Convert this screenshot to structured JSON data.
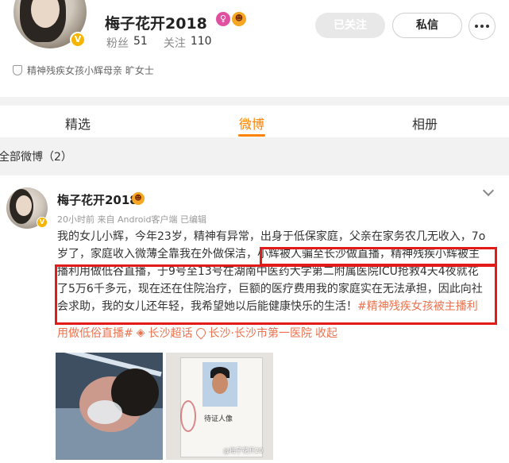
{
  "profile": {
    "name": "梅子花开2018",
    "verified_badge": "V",
    "name_icons": [
      "pink-badge-icon",
      "emoji-icon"
    ],
    "fans_label": "粉丝",
    "fans_count": "51",
    "following_label": "关注",
    "following_count": "110",
    "followed_button": "已关注",
    "message_button": "私信",
    "bio": "精神残疾女孩小辉母亲 旷女士"
  },
  "tabs": [
    {
      "label": "精选",
      "active": false
    },
    {
      "label": "微博",
      "active": true
    },
    {
      "label": "相册",
      "active": false
    }
  ],
  "feed": {
    "all_posts_label": "全部微博（2）"
  },
  "post": {
    "author": "梅子花开2018",
    "meta": "20小时前 来自 Android客户端 已编辑",
    "text_line1": "我的女儿小辉，今年23岁，精神有异常，出身于低保家庭，父亲在家务农几无收入，7o",
    "text_line2": "岁了，家庭收入微薄全靠我在外做保洁，小辉被人骗至长沙做直播，精神残疾小辉被主",
    "text_line3": "播利用做低谷直播，于9号至13号在湖南中医药大学第二附属医院ICU抢救4天4夜就花",
    "text_line4": "了5万6千多元，现在还在住院治疗，巨额的医疗费用我的家庭实在无法承担，因此向社",
    "text_line5_plain": "会求助，我的女儿还年轻，我希望她以后能健康快乐的生活！",
    "text_line5_tag": "#精神残疾女孩被主播利",
    "tag_line_part1": "用做低俗直播#",
    "tag_line_part2": "长沙超话",
    "tag_line_part3": "长沙·长沙市第一医院",
    "tag_line_part4": "收起",
    "image2_caption": "待证人像",
    "image2_watermark": "@梅子花开20"
  },
  "colors": {
    "accent": "#ff8200",
    "link": "#eb7350",
    "highlight_box": "#e31a1a"
  }
}
